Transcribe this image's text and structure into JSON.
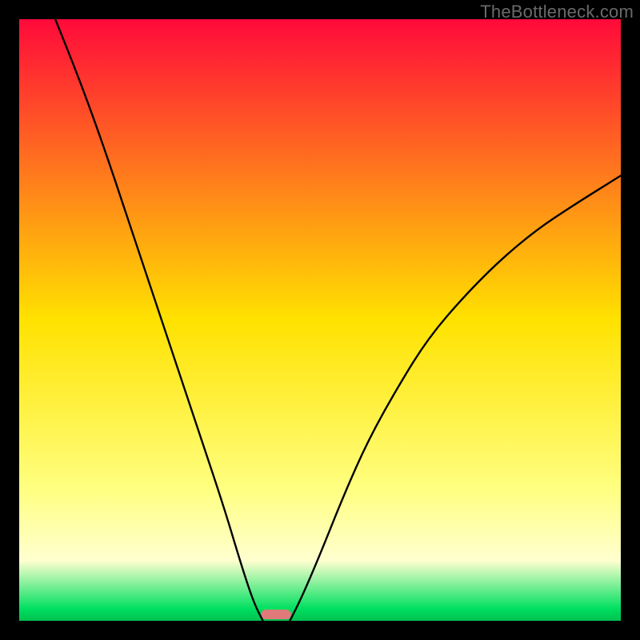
{
  "watermark": "TheBottleneck.com",
  "chart_data": {
    "type": "line",
    "title": "",
    "xlabel": "",
    "ylabel": "",
    "xlim": [
      0,
      100
    ],
    "ylim": [
      0,
      100
    ],
    "background_gradient": [
      {
        "at": 0,
        "color": "#ff0a3a"
      },
      {
        "at": 50,
        "color": "#ffe200"
      },
      {
        "at": 78,
        "color": "#ffff80"
      },
      {
        "at": 90,
        "color": "#ffffd0"
      },
      {
        "at": 98,
        "color": "#00e060"
      },
      {
        "at": 100,
        "color": "#00c050"
      }
    ],
    "series": [
      {
        "name": "left-curve",
        "x": [
          6,
          10,
          14,
          18,
          22,
          26,
          30,
          34,
          37,
          39,
          40.5
        ],
        "y": [
          100,
          90,
          79,
          67,
          55,
          43,
          31,
          19,
          9,
          3,
          0
        ]
      },
      {
        "name": "right-curve",
        "x": [
          45,
          47,
          50,
          54,
          58,
          63,
          68,
          74,
          80,
          86,
          92,
          100
        ],
        "y": [
          0,
          4,
          11,
          21,
          30,
          39,
          47,
          54,
          60,
          65,
          69,
          74
        ]
      }
    ],
    "marker": {
      "name": "bottleneck-marker",
      "x_center": 42.7,
      "width": 5,
      "color": "#e07a7a"
    }
  }
}
